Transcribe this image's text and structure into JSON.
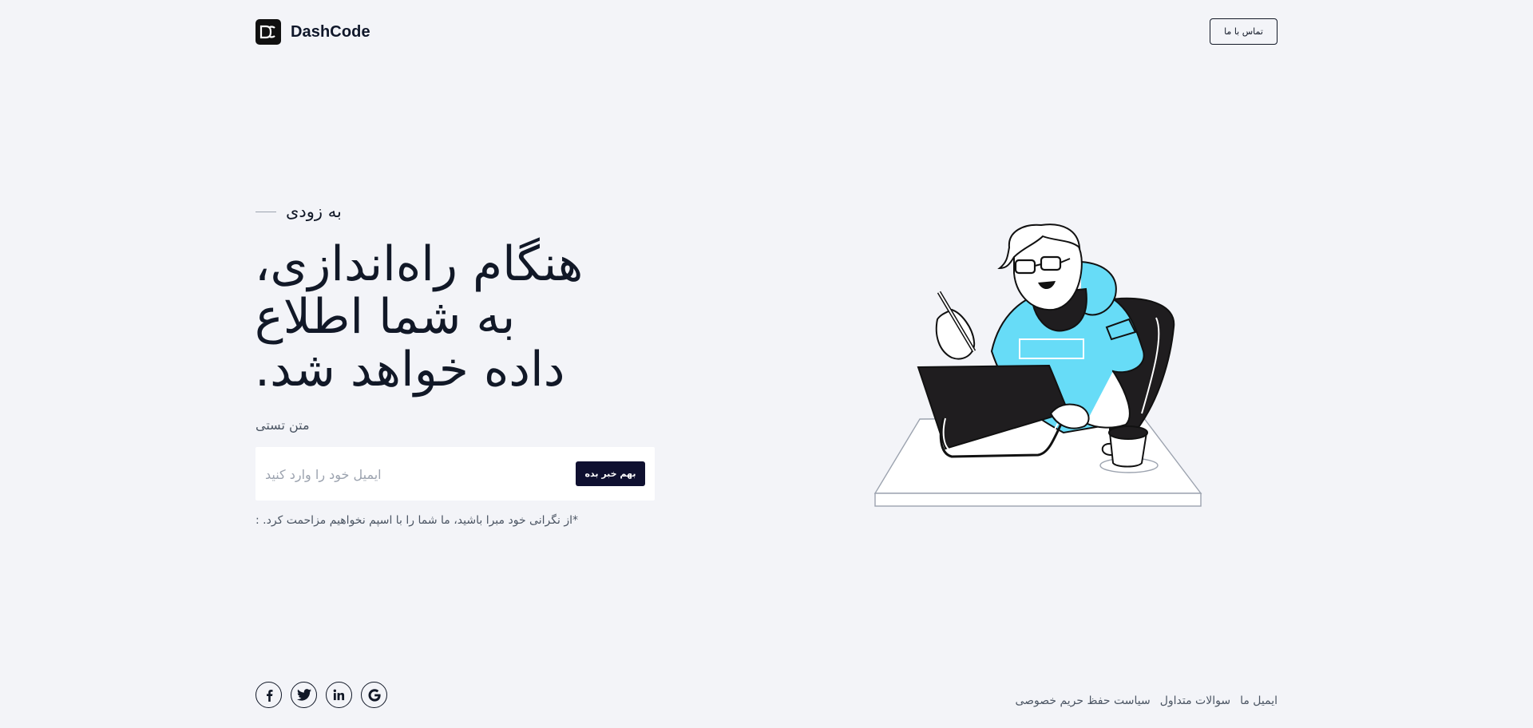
{
  "header": {
    "brand_name": "DashCode",
    "contact_label": "تماس با ما"
  },
  "hero": {
    "eyebrow": "به زودی",
    "headline_lines": [
      "هنگام راه‌اندازی،",
      "به شما اطلاع",
      "داده خواهد شد."
    ],
    "subtext": "متن تستی",
    "email_placeholder": "ایمیل خود را وارد کنید",
    "email_value": "",
    "notify_label": "بهم خبر بده",
    "disclaimer": "*از نگرانی خود مبرا باشید، ما شما را با اسپم نخواهیم مزاحمت کرد. :"
  },
  "footer": {
    "socials": [
      "facebook-icon",
      "twitter-icon",
      "linkedin-icon",
      "google-icon"
    ],
    "links": [
      "ایمیل ما",
      "سوالات متداول",
      "سیاست حفظ حریم خصوصی"
    ]
  },
  "colors": {
    "background": "#f3f4f8",
    "primary_dark": "#0f1030",
    "accent_cyan": "#67dcf7"
  }
}
